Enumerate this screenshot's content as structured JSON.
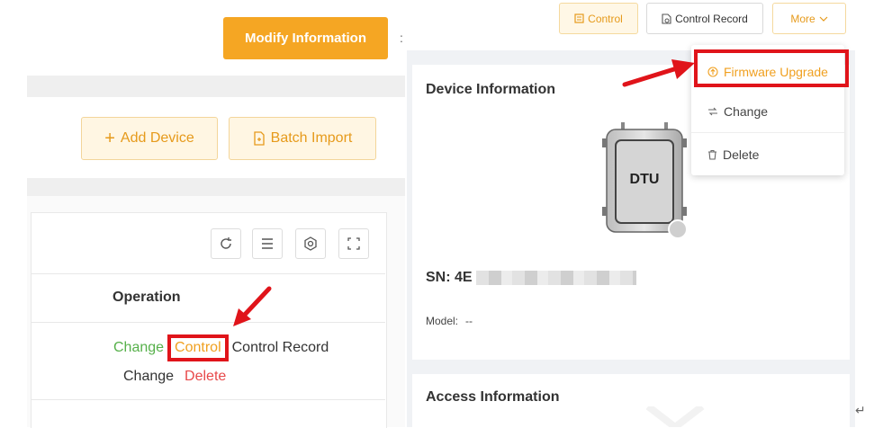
{
  "left": {
    "modify_btn": "Modify Information",
    "colon": ":",
    "add_device": "Add Device",
    "add_icon": "+",
    "batch_import": "Batch Import",
    "table": {
      "op_header": "Operation",
      "row1": {
        "change": "Change",
        "control": "Control",
        "control_record": "Control Record"
      },
      "row2": {
        "change": "Change",
        "delete": "Delete"
      }
    }
  },
  "right": {
    "header": {
      "control": "Control",
      "control_record": "Control Record",
      "more": "More"
    },
    "dropdown": {
      "firmware_upgrade": "Firmware Upgrade",
      "change": "Change",
      "delete": "Delete"
    },
    "device": {
      "title": "Device Information",
      "dtu_label": "DTU",
      "sn_label": "SN: 4E",
      "model_label": "Model:",
      "model_value": "--"
    },
    "access": {
      "title": "Access Information"
    }
  },
  "colors": {
    "accent": "#f5a623",
    "highlight": "#e0141a",
    "link_green": "#56b04a",
    "link_red": "#e8494a"
  },
  "icons": [
    "refresh-icon",
    "columns-icon",
    "settings-icon",
    "fullscreen-icon",
    "upload-icon",
    "swap-icon",
    "trash-icon",
    "document-icon",
    "chevron-down-icon"
  ]
}
